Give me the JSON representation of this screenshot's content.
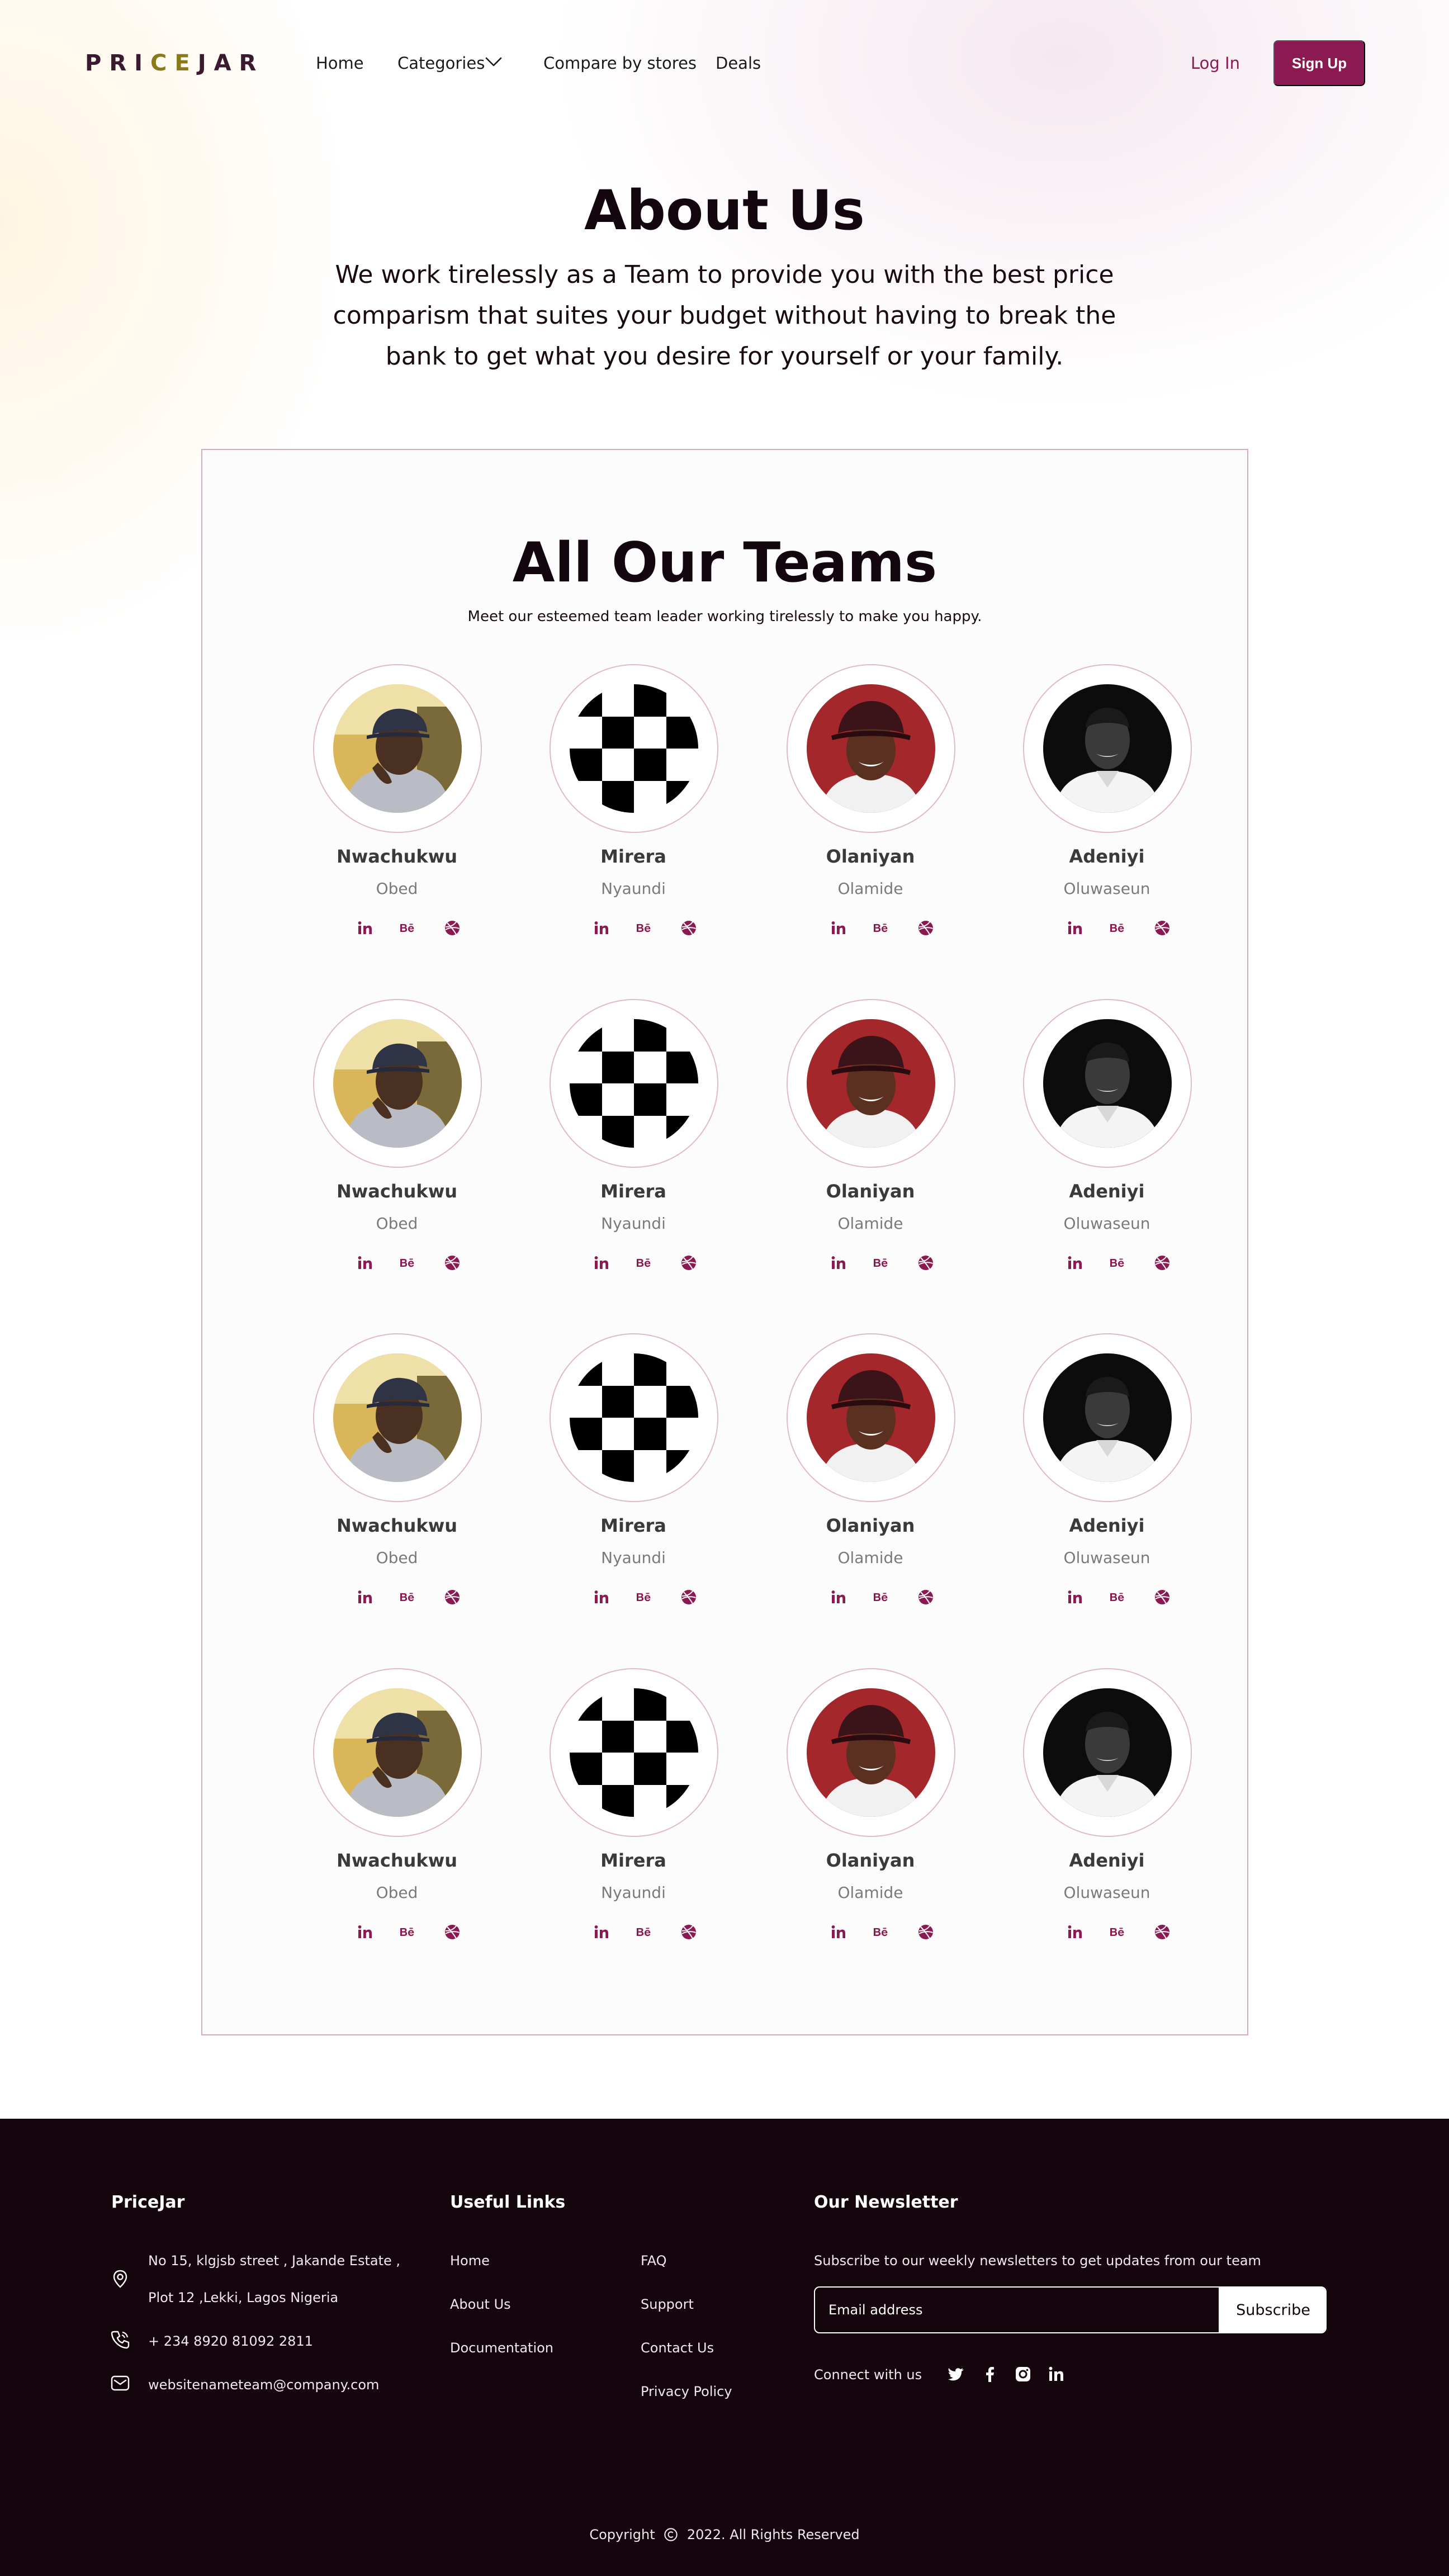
{
  "nav": {
    "logo": [
      "PRI",
      "CE",
      "JAR"
    ],
    "links": [
      "Home",
      "Categories",
      "Compare by stores",
      "Deals"
    ],
    "login": "Log In",
    "signup": "Sign Up"
  },
  "hero": {
    "title": "About Us",
    "text": "We work tirelessly as a Team to provide you with the best price comparism that suites your budget without having to break the bank to get what you desire for yourself or your family."
  },
  "team": {
    "title": "All Our Teams",
    "subtitle": "Meet our esteemed team leader working tirelessly to make you happy.",
    "members": [
      {
        "first": "Nwachukwu",
        "last": "Obed",
        "photo": "photo-cap"
      },
      {
        "first": "Mirera",
        "last": "Nyaundi",
        "photo": "photo-checker"
      },
      {
        "first": "Olaniyan",
        "last": "Olamide",
        "photo": "photo-hat"
      },
      {
        "first": "Adeniyi",
        "last": "Oluwaseun",
        "photo": "photo-bw"
      },
      {
        "first": "Nwachukwu",
        "last": "Obed",
        "photo": "photo-cap"
      },
      {
        "first": "Mirera",
        "last": "Nyaundi",
        "photo": "photo-checker"
      },
      {
        "first": "Olaniyan",
        "last": "Olamide",
        "photo": "photo-hat"
      },
      {
        "first": "Adeniyi",
        "last": "Oluwaseun",
        "photo": "photo-bw"
      },
      {
        "first": "Nwachukwu",
        "last": "Obed",
        "photo": "photo-cap"
      },
      {
        "first": "Mirera",
        "last": "Nyaundi",
        "photo": "photo-checker"
      },
      {
        "first": "Olaniyan",
        "last": "Olamide",
        "photo": "photo-hat"
      },
      {
        "first": "Adeniyi",
        "last": "Oluwaseun",
        "photo": "photo-bw"
      },
      {
        "first": "Nwachukwu",
        "last": "Obed",
        "photo": "photo-cap"
      },
      {
        "first": "Mirera",
        "last": "Nyaundi",
        "photo": "photo-checker"
      },
      {
        "first": "Olaniyan",
        "last": "Olamide",
        "photo": "photo-hat"
      },
      {
        "first": "Adeniyi",
        "last": "Oluwaseun",
        "photo": "photo-bw"
      }
    ],
    "social_icons": [
      "linkedin-icon",
      "behance-icon",
      "dribbble-icon"
    ]
  },
  "footer": {
    "brand": "PriceJar",
    "address_line1": "No 15, klgjsb street , Jakande Estate ,",
    "address_line2": "Plot 12 ,Lekki, Lagos Nigeria",
    "phone": "+ 234 8920 81092 2811",
    "email": "websitenameteam@company.com",
    "links_title": "Useful Links",
    "links_col1": [
      "Home",
      "About Us",
      "Documentation"
    ],
    "links_col2": [
      "FAQ",
      "Support",
      "Contact Us",
      "Privacy Policy"
    ],
    "newsletter_title": "Our Newsletter",
    "newsletter_text": "Subscribe to our weekly newsletters to get updates from our team",
    "email_placeholder": "Email address",
    "subscribe": "Subscribe",
    "connect": "Connect with us",
    "connect_icons": [
      "twitter-icon",
      "facebook-icon",
      "instagram-icon",
      "linkedin-icon"
    ],
    "copyright_before": "Copyright",
    "copyright_after": "2022. All Rights Reserved"
  },
  "colors": {
    "accent": "#8b1a52",
    "footer_bg": "#15050d",
    "card_border": "#d9a9bd"
  }
}
